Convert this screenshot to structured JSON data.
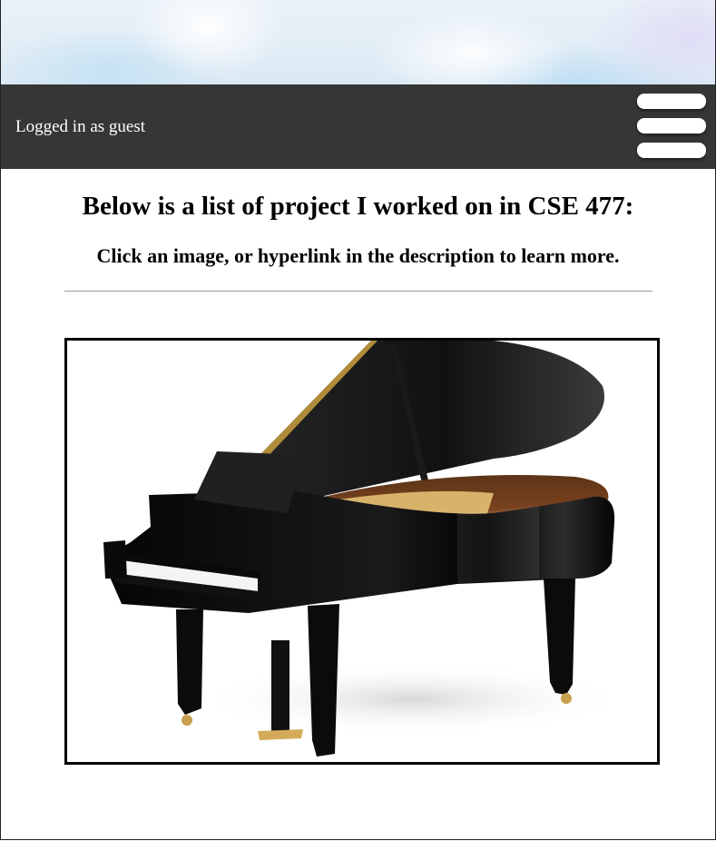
{
  "header": {
    "login_status": "Logged in as guest",
    "menu_icon": "hamburger-menu-icon"
  },
  "main": {
    "heading": "Below is a list of project I worked on in CSE 477:",
    "subheading": "Click an image, or hyperlink in the description to learn more.",
    "projects": [
      {
        "image": "grand-piano-image",
        "image_alt": "Grand piano"
      }
    ]
  },
  "colors": {
    "nav_bar": "#363636",
    "menu_bars": "#ffffff",
    "image_border": "#000000",
    "divider": "#9a9a9a"
  }
}
